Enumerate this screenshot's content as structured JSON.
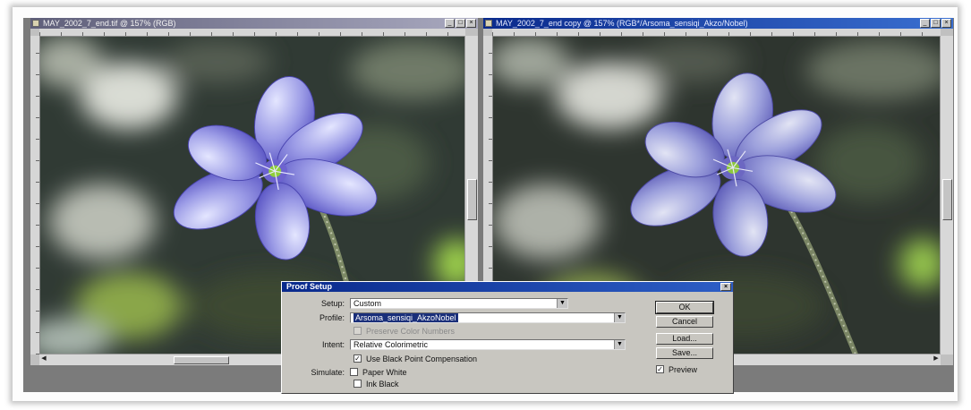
{
  "windows": {
    "left": {
      "title": "MAY_2002_7_end.tif @ 157% (RGB)"
    },
    "right": {
      "title": "MAY_2002_7_end copy @ 157% (RGB*/Arsoma_sensiqi_Akzo/Nobel)"
    },
    "window_buttons": [
      "_",
      "□",
      "×"
    ]
  },
  "proof_setup": {
    "title": "Proof Setup",
    "setup": {
      "label": "Setup:",
      "value": "Custom"
    },
    "profile": {
      "label": "Profile:",
      "value": "Arsoma_sensiqi_AkzoNobel"
    },
    "preserve_color_numbers": {
      "label": "Preserve Color Numbers",
      "checked": false,
      "enabled": false
    },
    "intent": {
      "label": "Intent:",
      "value": "Relative Colorimetric"
    },
    "black_point": {
      "label": "Use Black Point Compensation",
      "checked": true
    },
    "simulate": {
      "label": "Simulate:",
      "paper_white": {
        "label": "Paper White",
        "checked": false
      },
      "ink_black": {
        "label": "Ink Black",
        "checked": false
      }
    },
    "buttons": {
      "ok": "OK",
      "cancel": "Cancel",
      "load": "Load...",
      "save": "Save..."
    },
    "preview": {
      "label": "Preview",
      "checked": true
    }
  },
  "icons": {
    "app": "document-icon",
    "dropdown": "chevron-down-icon",
    "checkmark": "check-icon"
  },
  "colors": {
    "titlebar_active": "#0a2a8c",
    "titlebar_inactive": "#5f5f7a",
    "dialog_bg": "#c8c6c0",
    "workspace": "#7b7b7b",
    "petal": "#9a9ae6"
  }
}
